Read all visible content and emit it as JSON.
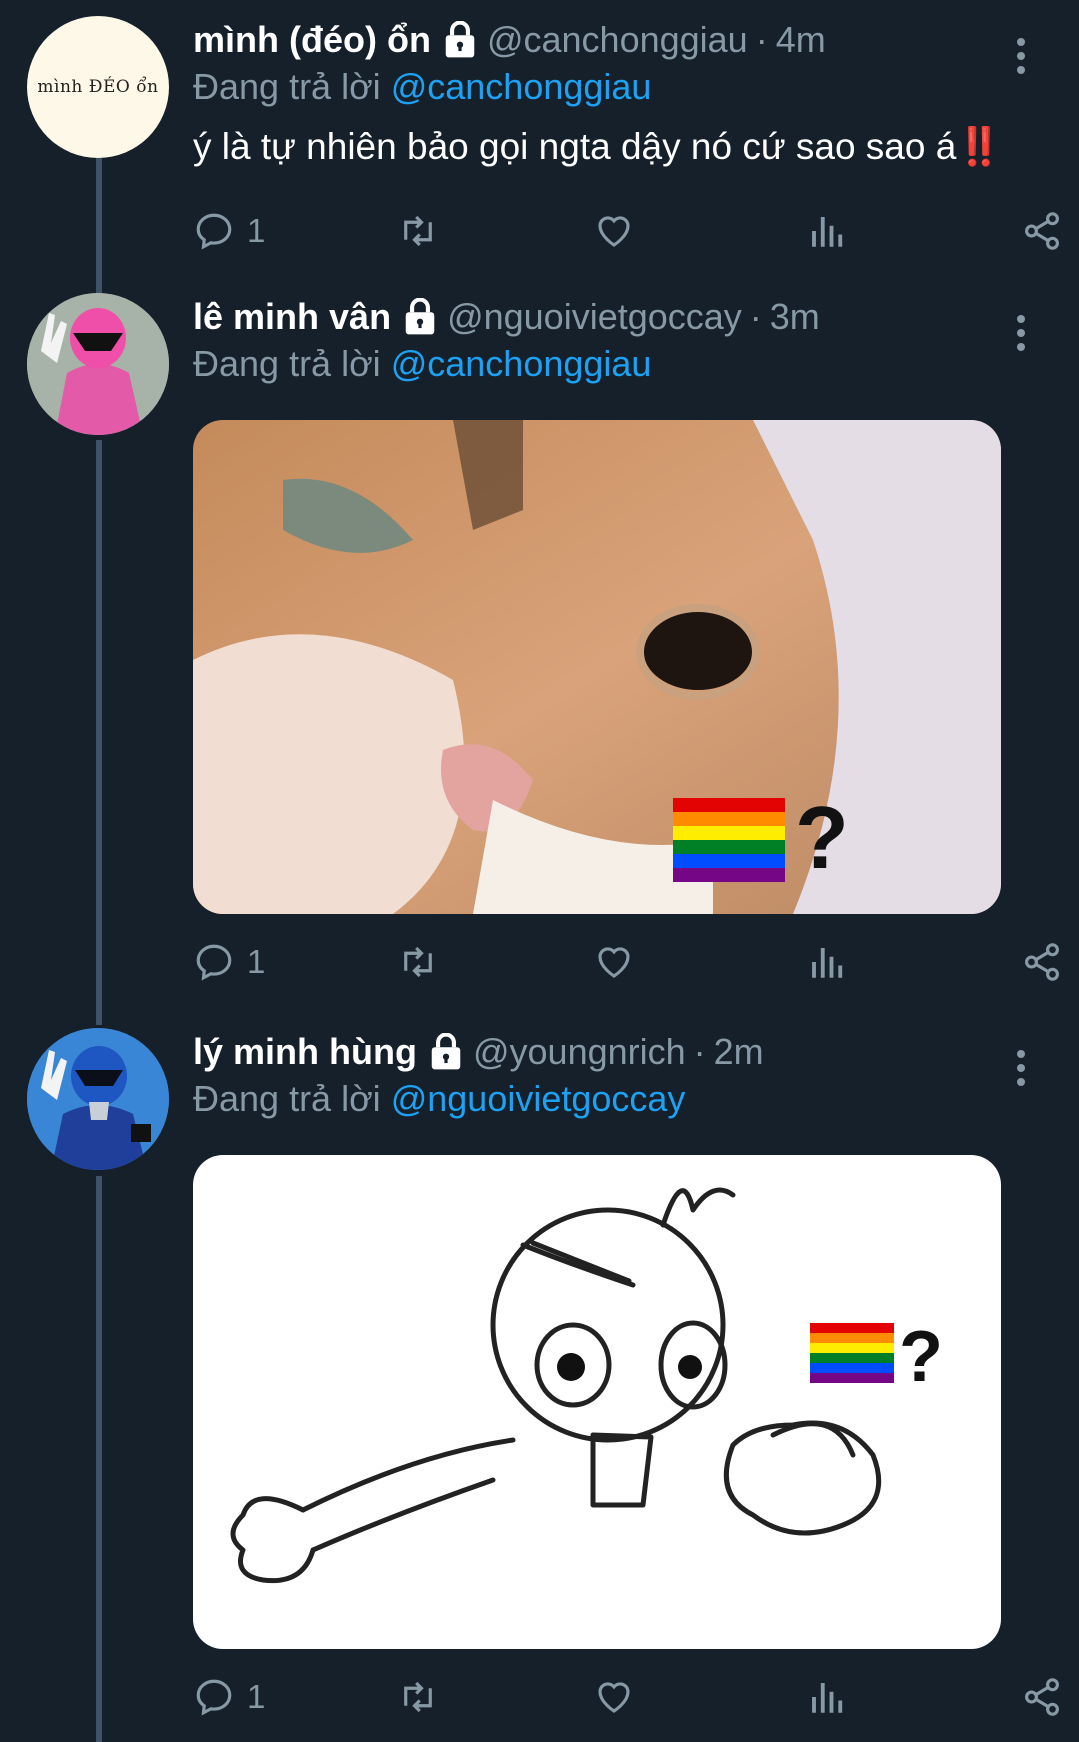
{
  "tweets": [
    {
      "avatar_text": "mình ĐÉO ổn",
      "name": "mình (đéo) ổn",
      "handle": "@canchonggiau",
      "time": "4m",
      "reply_prefix": "Đang trả lời",
      "reply_to": "@canchonggiau",
      "text": "ý là tự nhiên bảo gọi ngta dậy nó cứ sao sao á",
      "text_emoji": "‼️",
      "reply_count": "1"
    },
    {
      "name": "lê minh vân",
      "handle": "@nguoivietgoccay",
      "time": "3m",
      "reply_prefix": "Đang trả lời",
      "reply_to": "@canchonggiau",
      "media_caption": "?",
      "reply_count": "1"
    },
    {
      "name": "lý minh hùng",
      "handle": "@youngnrich",
      "time": "2m",
      "reply_prefix": "Đang trả lời",
      "reply_to": "@nguoivietgoccay",
      "media_caption": "?",
      "reply_count": "1"
    }
  ],
  "icons": [
    "lock-icon",
    "more-vertical-icon",
    "reply-icon",
    "retweet-icon",
    "like-icon",
    "analytics-icon",
    "share-icon"
  ],
  "colors": {
    "background": "#15202b",
    "link": "#1da1f2",
    "muted": "#8899a6",
    "thread_line": "#3d5466"
  }
}
